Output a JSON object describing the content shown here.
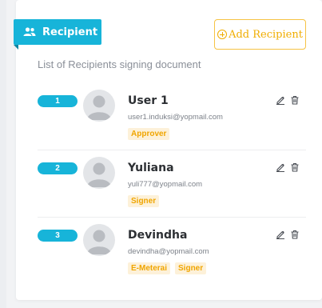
{
  "panel": {
    "title": "Recipient",
    "add_button_label": "Add Recipient",
    "subtitle": "List of Recipients signing document"
  },
  "recipients": [
    {
      "number": "1",
      "name": "User 1",
      "email": "user1.induksi@yopmail.com",
      "roles": [
        "Approver"
      ]
    },
    {
      "number": "2",
      "name": "Yuliana",
      "email": "yuli777@yopmail.com",
      "roles": [
        "Signer"
      ]
    },
    {
      "number": "3",
      "name": "Devindha",
      "email": "devindha@yopmail.com",
      "roles": [
        "E-Meterai",
        "Signer"
      ]
    }
  ],
  "icons": {
    "header": "users-icon",
    "add": "plus-circle-icon",
    "avatar": "user-avatar-icon",
    "edit": "pencil-icon",
    "delete": "trash-icon"
  },
  "colors": {
    "accent": "#17b4d9",
    "warning": "#f0ad00",
    "badge_bg": "#fdf1d9"
  }
}
